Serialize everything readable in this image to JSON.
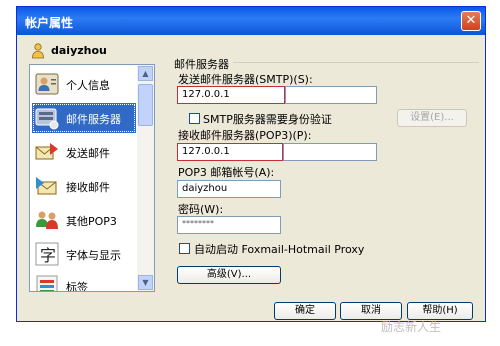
{
  "window": {
    "title": "帐户属性",
    "close_glyph": "✕"
  },
  "account": {
    "name": "daiyzhou"
  },
  "sidebar": {
    "items": [
      {
        "label": "个人信息",
        "icon": "person-card-icon"
      },
      {
        "label": "邮件服务器",
        "icon": "mail-server-icon",
        "selected": true
      },
      {
        "label": "发送邮件",
        "icon": "send-mail-icon"
      },
      {
        "label": "接收邮件",
        "icon": "receive-mail-icon"
      },
      {
        "label": "其他POP3",
        "icon": "pop3-accounts-icon"
      },
      {
        "label": "字体与显示",
        "icon": "font-display-icon"
      },
      {
        "label": "标签",
        "icon": "tag-icon"
      }
    ],
    "scroll_up": "▲",
    "scroll_down": "▼"
  },
  "mail_server": {
    "section_title": "邮件服务器",
    "smtp_label": "发送邮件服务器(SMTP)(S):",
    "smtp_value": "127.0.0.1",
    "smtp_auth_label": "SMTP服务器需要身份验证",
    "smtp_auth_checked": false,
    "settings_button": "设置(E)...",
    "pop3_label": "接收邮件服务器(POP3)(P):",
    "pop3_value": "127.0.0.1",
    "account_label": "POP3 邮箱帐号(A):",
    "account_value": "daiyzhou",
    "password_label": "密码(W):",
    "password_value": "********",
    "foxmail_label": "自动启动 Foxmail-Hotmail Proxy",
    "foxmail_checked": false,
    "advanced_button": "高级(V)..."
  },
  "footer": {
    "ok_button": "确定",
    "cancel_button": "取消",
    "help_button": "帮助(H)"
  },
  "watermark": {
    "text": "励志新人生"
  },
  "colors": {
    "titlebar": "#0a5ae8",
    "selected": "#316ac5",
    "highlight_border": "#c73030"
  }
}
